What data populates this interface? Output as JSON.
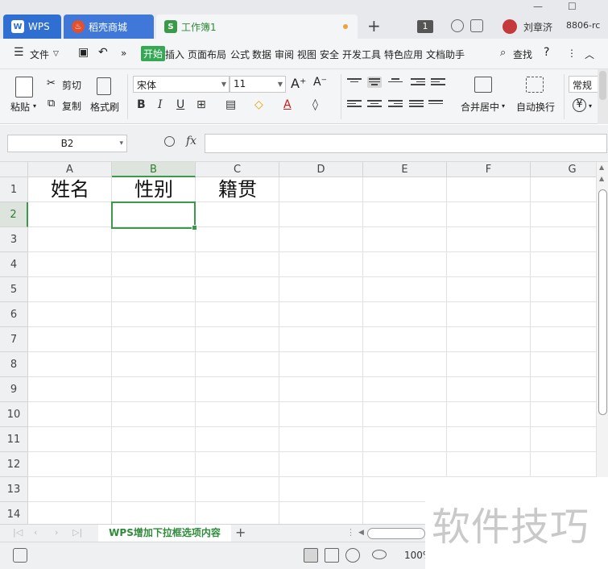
{
  "tabs": {
    "wps": "WPS",
    "docer": "稻壳商城",
    "workbook": "工作簿1",
    "wps_icon": "W",
    "docer_icon": "flame-icon",
    "workbook_icon": "S"
  },
  "titlebar": {
    "badge": "1",
    "user": "刘章济",
    "user_id": "8806-rc",
    "minimize": "—",
    "maximize": "☐",
    "add_tab": "+"
  },
  "menubar": {
    "file": "文件",
    "items": [
      "开始",
      "插入",
      "页面布局",
      "公式",
      "数据",
      "审阅",
      "视图",
      "安全",
      "开发工具",
      "特色应用",
      "文档助手"
    ],
    "search": "查找",
    "help": "?",
    "more": "⋮",
    "collapse": "︿"
  },
  "ribbon": {
    "paste": "粘贴",
    "cut": "剪切",
    "copy": "复制",
    "format_painter": "格式刷",
    "font_name": "宋体",
    "font_size": "11",
    "grow_font": "A⁺",
    "shrink_font": "A⁻",
    "bold": "B",
    "italic": "I",
    "underline": "U",
    "merge_center": "合并居中",
    "wrap_text": "自动换行",
    "number_format": "常规",
    "currency": "¥"
  },
  "formula_bar": {
    "name_box": "B2",
    "fx": "fx",
    "formula": ""
  },
  "sheet": {
    "columns": [
      "A",
      "B",
      "C",
      "D",
      "E",
      "F",
      "G"
    ],
    "rows": [
      "1",
      "2",
      "3",
      "4",
      "5",
      "6",
      "7",
      "8",
      "9",
      "10",
      "11",
      "12",
      "13",
      "14"
    ],
    "cells": {
      "A1": "姓名",
      "B1": "性别",
      "C1": "籍贯"
    },
    "selected_cell": "B2",
    "selected_column": "B",
    "selected_row": "2"
  },
  "sheet_tabs": {
    "active": "WPS增加下拉框选项内容",
    "add": "+"
  },
  "statusbar": {
    "zoom": "100%"
  },
  "watermark": "软件技巧"
}
